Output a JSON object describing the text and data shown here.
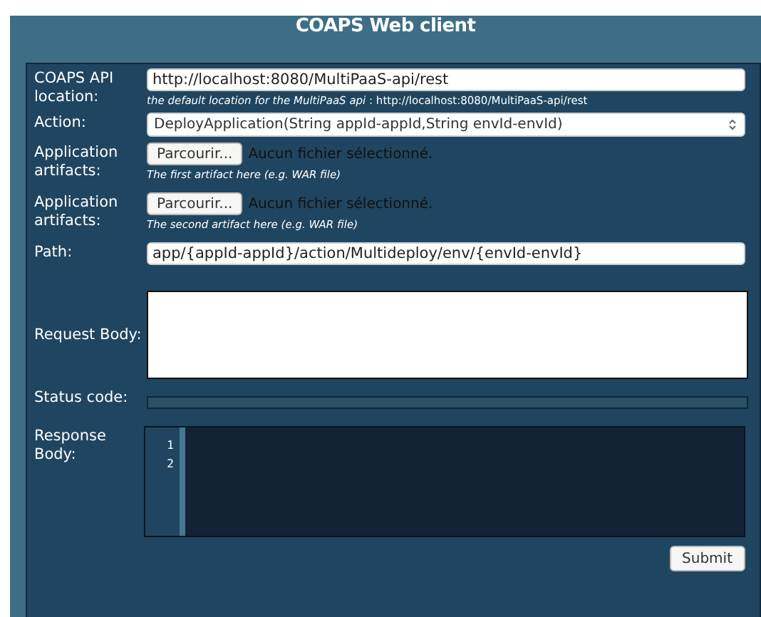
{
  "title": "COAPS Web client",
  "rows": [
    {
      "kind": "text",
      "label": "COAPS API location:",
      "value": "http://localhost:8080/MultiPaaS-api/rest",
      "hint": "*the default location for the MultiPaaS api* : http://localhost:8080/MultiPaaS-api/rest"
    },
    {
      "kind": "select",
      "label": "Action:",
      "value": "DeployApplication(String appId-appId,String envId-envId)"
    },
    {
      "kind": "file",
      "label": "Application artifacts:",
      "button": "Parcourir...",
      "status": "Aucun fichier sélectionné.",
      "hint": "The first artifact here (e.g. WAR file)"
    },
    {
      "kind": "file",
      "label": "Application artifacts:",
      "button": "Parcourir...",
      "status": "Aucun fichier sélectionné.",
      "hint": "The second artifact here (e.g. WAR file)"
    },
    {
      "kind": "text",
      "label": "Path:",
      "value": "app/{appId-appId}/action/Multideploy/env/{envId-envId}"
    },
    {
      "kind": "textarea",
      "label": "Request Body:"
    },
    {
      "kind": "status",
      "label": "Status code:"
    },
    {
      "kind": "code",
      "label": "Response Body:",
      "line_numbers": [
        "1",
        "2"
      ]
    }
  ],
  "submit": "Submit"
}
